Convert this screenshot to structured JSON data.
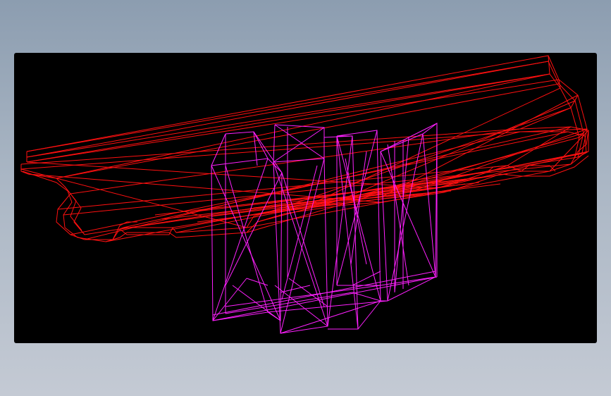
{
  "viewport": {
    "background": "#000000"
  },
  "model": {
    "deck_color": "#ff1010",
    "piers_color": "#ff20ff"
  }
}
